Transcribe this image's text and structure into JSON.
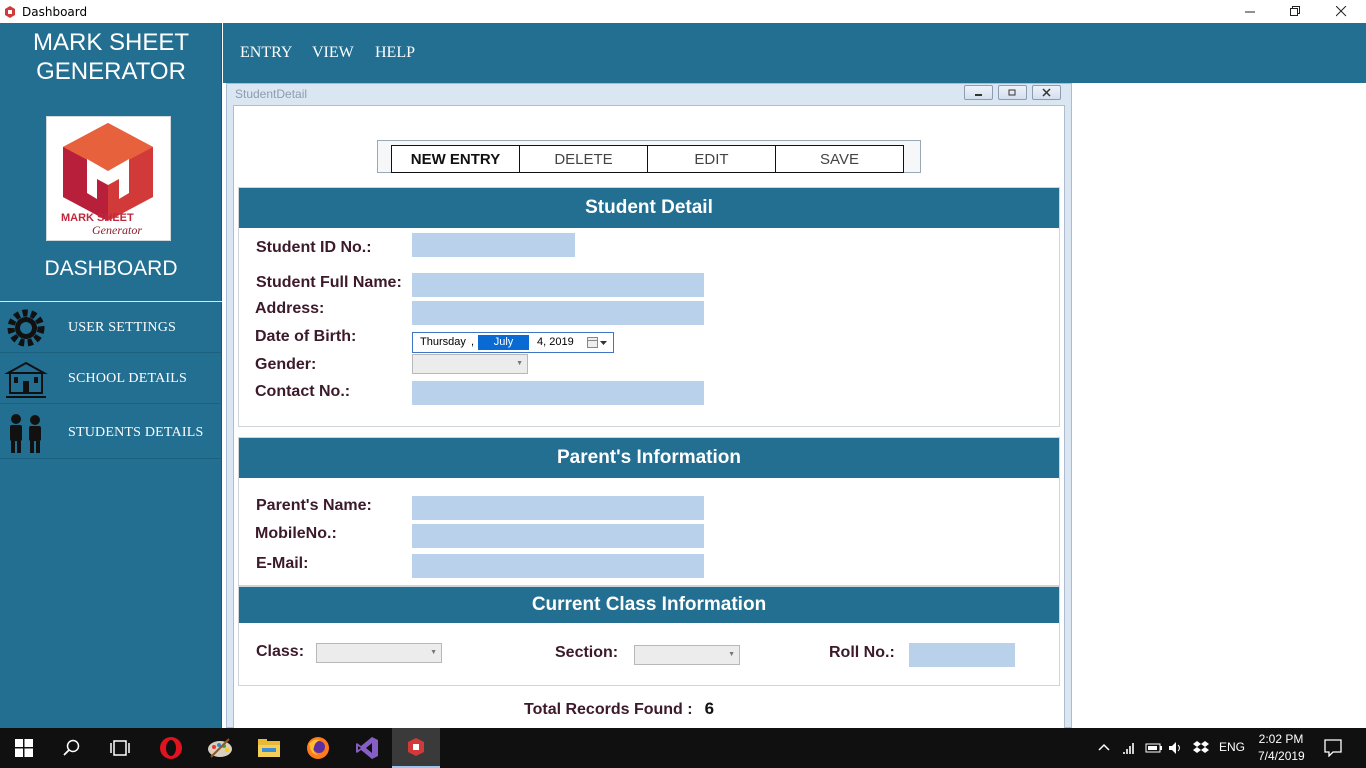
{
  "window": {
    "title": "Dashboard",
    "minimize_icon": "minimize-icon",
    "maximize_icon": "restore-icon",
    "close_icon": "close-icon"
  },
  "sidebar": {
    "brand_line1": "MARK SHEET",
    "brand_line2": "GENERATOR",
    "logo_text1": "MARK SHEET",
    "logo_text2": "Generator",
    "dashboard_label": "DASHBOARD",
    "items": [
      {
        "label": "USER SETTINGS",
        "icon": "gear-icon"
      },
      {
        "label": "SCHOOL DETAILS",
        "icon": "school-building-icon"
      },
      {
        "label": "STUDENTS DETAILS",
        "icon": "students-icon"
      }
    ]
  },
  "menubar": {
    "items": [
      "ENTRY",
      "VIEW",
      "HELP"
    ]
  },
  "child_window": {
    "title": "StudentDetail"
  },
  "toolbar": {
    "new_entry": "NEW ENTRY",
    "delete": "DELETE",
    "edit": "EDIT",
    "save": "SAVE"
  },
  "student_detail": {
    "heading": "Student Detail",
    "id_label": "Student ID No.:",
    "name_label": "Student Full Name:",
    "address_label": "Address:",
    "dob_label": "Date of Birth:",
    "gender_label": "Gender:",
    "contact_label": "Contact No.:",
    "dob_day": "Thursday",
    "dob_comma": ",",
    "dob_month": "July",
    "dob_rest": "4, 2019"
  },
  "parent_info": {
    "heading": "Parent's Information",
    "name_label": "Parent's Name:",
    "mobile_label": "MobileNo.:",
    "email_label": "E-Mail:"
  },
  "class_info": {
    "heading": "Current Class Information",
    "class_label": "Class:",
    "section_label": "Section:",
    "roll_label": "Roll No.:"
  },
  "footer": {
    "total_label": "Total Records Found :",
    "total_value": "6"
  },
  "taskbar": {
    "language": "ENG",
    "time": "2:02 PM",
    "date": "7/4/2019"
  },
  "colors": {
    "primary": "#226f92",
    "field": "#b9d1ea",
    "label": "#3c1a2a"
  }
}
